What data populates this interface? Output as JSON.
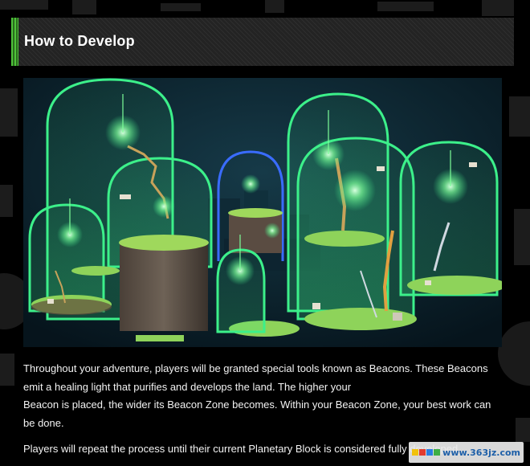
{
  "section": {
    "title": "How to Develop"
  },
  "screenshot": {
    "colors": {
      "sky": "#0b2230",
      "dome_green": "#3cf08a",
      "dome_blue": "#3a6cff",
      "beacon_glow": "#7dff9a",
      "ground": "#8ed35a"
    }
  },
  "paragraphs": [
    {
      "lines": [
        "Throughout your adventure, players will be granted special tools known as Beacons. These Beacons",
        "emit a healing light that purifies and develops the land. The higher your",
        "Beacon is placed, the wider its Beacon Zone becomes. Within your Beacon Zone, your best work can",
        "be done."
      ]
    },
    {
      "lines": [
        "Players will repeat the process until their current Planetary Block is considered fully developed."
      ]
    }
  ],
  "watermark": {
    "text": "www.363jz.com",
    "logo_colors": [
      "#f2c20c",
      "#e23b2f",
      "#2b7de0",
      "#3fae45"
    ]
  }
}
